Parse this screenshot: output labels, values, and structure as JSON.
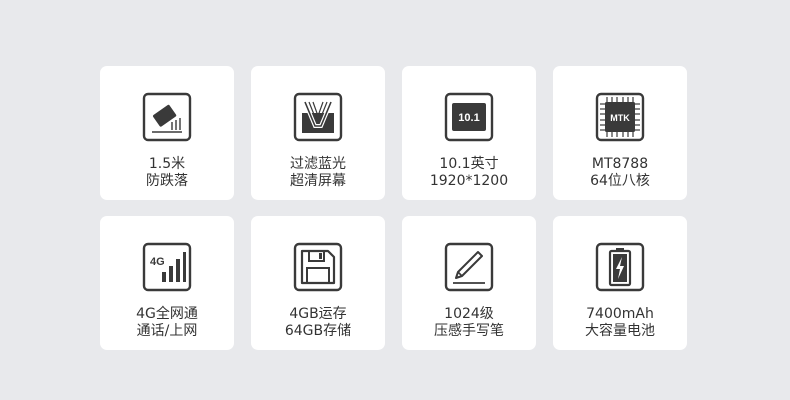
{
  "features": [
    {
      "icon": "drop-proof-icon",
      "line1": "1.5米",
      "line2": "防跌落"
    },
    {
      "icon": "blue-light-filter-icon",
      "line1": "过滤蓝光",
      "line2": "超清屏幕"
    },
    {
      "icon": "screen-size-icon",
      "line1": "10.1英寸",
      "line2": "1920*1200",
      "badge": "10.1"
    },
    {
      "icon": "cpu-chip-icon",
      "line1": "MT8788",
      "line2": "64位八核",
      "badge": "MTK"
    },
    {
      "icon": "signal-4g-icon",
      "line1": "4G全网通",
      "line2": "通话/上网",
      "badge": "4G"
    },
    {
      "icon": "floppy-disk-icon",
      "line1": "4GB运存",
      "line2": "64GB存储"
    },
    {
      "icon": "stylus-pen-icon",
      "line1": "1024级",
      "line2": "压感手写笔"
    },
    {
      "icon": "battery-icon",
      "line1": "7400mAh",
      "line2": "大容量电池"
    }
  ],
  "colors": {
    "background": "#e8e9ec",
    "card": "#ffffff",
    "icon": "#3a3a3a",
    "text": "#333333"
  }
}
